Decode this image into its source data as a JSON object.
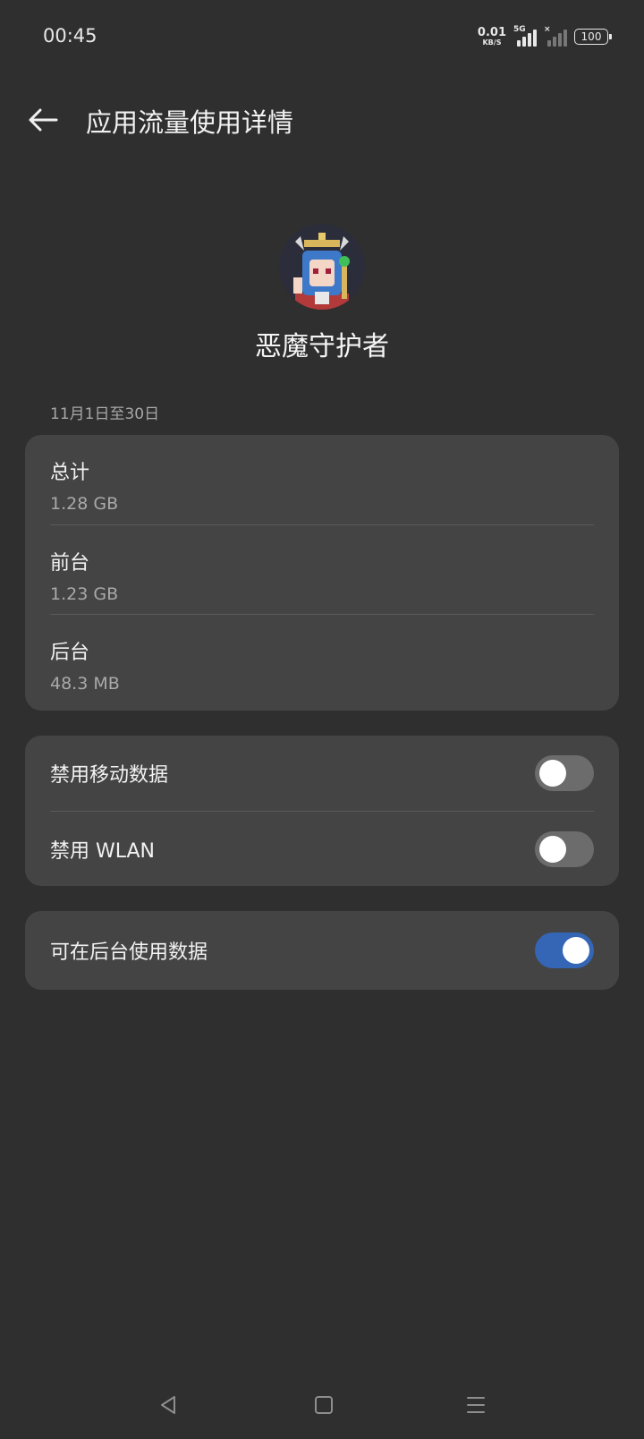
{
  "status_bar": {
    "time": "00:45",
    "net_speed_value": "0.01",
    "net_speed_unit": "KB/S",
    "signal_tag": "5G",
    "signal_secondary_tag": "×",
    "battery_level": "100"
  },
  "header": {
    "back_icon": "arrow-left-icon",
    "title": "应用流量使用详情"
  },
  "app": {
    "name": "恶魔守护者",
    "icon": "app-avatar-icon"
  },
  "date_range": "11月1日至30日",
  "usage": [
    {
      "label": "总计",
      "value": "1.28 GB"
    },
    {
      "label": "前台",
      "value": "1.23 GB"
    },
    {
      "label": "后台",
      "value": "48.3 MB"
    }
  ],
  "toggles": [
    {
      "label": "禁用移动数据",
      "enabled": false
    },
    {
      "label": "禁用 WLAN",
      "enabled": false
    }
  ],
  "background_data": {
    "label": "可在后台使用数据",
    "enabled": true
  },
  "nav": {
    "back_icon": "triangle-back-icon",
    "home_icon": "square-home-icon",
    "menu_icon": "menu-lines-icon"
  },
  "colors": {
    "background": "#2f2f2f",
    "card": "#444444",
    "switch_on": "#3466b5",
    "switch_off": "#6c6c6c"
  }
}
